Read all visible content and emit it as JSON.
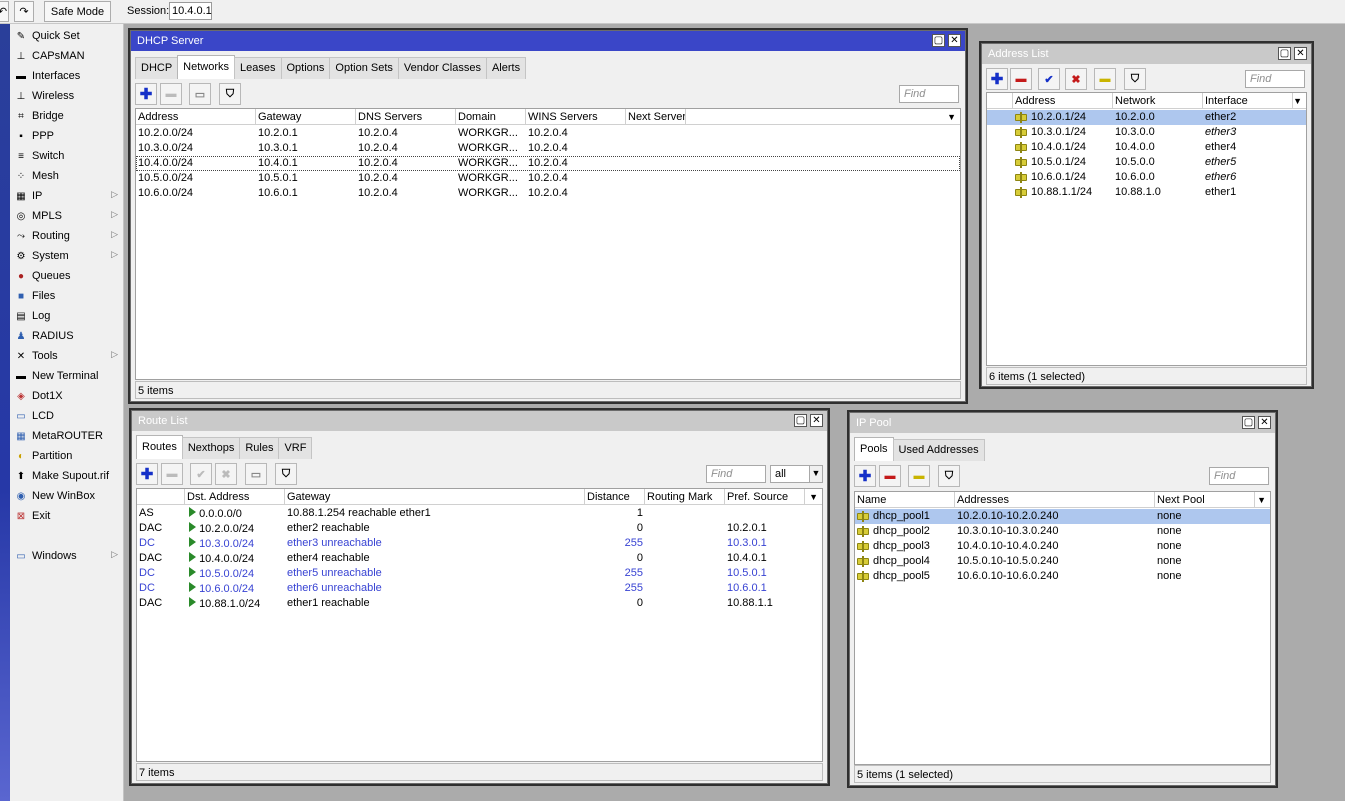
{
  "topbar": {
    "safe_mode": "Safe Mode",
    "session_label": "Session:",
    "session_value": "10.4.0.1"
  },
  "sidebar": {
    "items": [
      {
        "label": "Quick Set",
        "icon": "wand-icon"
      },
      {
        "label": "CAPsMAN",
        "icon": "capsman-icon"
      },
      {
        "label": "Interfaces",
        "icon": "interfaces-icon"
      },
      {
        "label": "Wireless",
        "icon": "wireless-icon"
      },
      {
        "label": "Bridge",
        "icon": "bridge-icon"
      },
      {
        "label": "PPP",
        "icon": "ppp-icon"
      },
      {
        "label": "Switch",
        "icon": "switch-icon"
      },
      {
        "label": "Mesh",
        "icon": "mesh-icon"
      },
      {
        "label": "IP",
        "icon": "ip-icon"
      },
      {
        "label": "MPLS",
        "icon": "mpls-icon"
      },
      {
        "label": "Routing",
        "icon": "routing-icon"
      },
      {
        "label": "System",
        "icon": "system-icon"
      },
      {
        "label": "Queues",
        "icon": "queues-icon"
      },
      {
        "label": "Files",
        "icon": "files-icon"
      },
      {
        "label": "Log",
        "icon": "log-icon"
      },
      {
        "label": "RADIUS",
        "icon": "radius-icon"
      },
      {
        "label": "Tools",
        "icon": "tools-icon"
      },
      {
        "label": "New Terminal",
        "icon": "terminal-icon"
      },
      {
        "label": "Dot1X",
        "icon": "dot1x-icon"
      },
      {
        "label": "LCD",
        "icon": "lcd-icon"
      },
      {
        "label": "MetaROUTER",
        "icon": "metarouter-icon"
      },
      {
        "label": "Partition",
        "icon": "partition-icon"
      },
      {
        "label": "Make Supout.rif",
        "icon": "supout-icon"
      },
      {
        "label": "New WinBox",
        "icon": "winbox-icon"
      },
      {
        "label": "Exit",
        "icon": "exit-icon"
      },
      {
        "label": "Windows",
        "icon": "windows-icon"
      }
    ]
  },
  "dhcp": {
    "title": "DHCP Server",
    "tabs": [
      "DHCP",
      "Networks",
      "Leases",
      "Options",
      "Option Sets",
      "Vendor Classes",
      "Alerts"
    ],
    "find": "Find",
    "columns": [
      "Address",
      "Gateway",
      "DNS Servers",
      "Domain",
      "WINS Servers",
      "Next Server"
    ],
    "rows": [
      [
        "10.2.0.0/24",
        "10.2.0.1",
        "10.2.0.4",
        "WORKGR...",
        "10.2.0.4",
        ""
      ],
      [
        "10.3.0.0/24",
        "10.3.0.1",
        "10.2.0.4",
        "WORKGR...",
        "10.2.0.4",
        ""
      ],
      [
        "10.4.0.0/24",
        "10.4.0.1",
        "10.2.0.4",
        "WORKGR...",
        "10.2.0.4",
        ""
      ],
      [
        "10.5.0.0/24",
        "10.5.0.1",
        "10.2.0.4",
        "WORKGR...",
        "10.2.0.4",
        ""
      ],
      [
        "10.6.0.0/24",
        "10.6.0.1",
        "10.2.0.4",
        "WORKGR...",
        "10.2.0.4",
        ""
      ]
    ],
    "status": "5 items"
  },
  "address_list": {
    "title": "Address List",
    "find": "Find",
    "columns": [
      "Address",
      "Network",
      "Interface"
    ],
    "rows": [
      [
        "10.2.0.1/24",
        "10.2.0.0",
        "ether2"
      ],
      [
        "10.3.0.1/24",
        "10.3.0.0",
        "ether3"
      ],
      [
        "10.4.0.1/24",
        "10.4.0.0",
        "ether4"
      ],
      [
        "10.5.0.1/24",
        "10.5.0.0",
        "ether5"
      ],
      [
        "10.6.0.1/24",
        "10.6.0.0",
        "ether6"
      ],
      [
        "10.88.1.1/24",
        "10.88.1.0",
        "ether1"
      ]
    ],
    "status": "6 items (1 selected)"
  },
  "route_list": {
    "title": "Route List",
    "tabs": [
      "Routes",
      "Nexthops",
      "Rules",
      "VRF"
    ],
    "find": "Find",
    "filter_value": "all",
    "columns": [
      "",
      "Dst. Address",
      "Gateway",
      "Distance",
      "Routing Mark",
      "Pref. Source"
    ],
    "rows": [
      [
        "AS",
        "0.0.0.0/0",
        "10.88.1.254 reachable ether1",
        "1",
        "",
        ""
      ],
      [
        "DAC",
        "10.2.0.0/24",
        "ether2 reachable",
        "0",
        "",
        "10.2.0.1"
      ],
      [
        "DC",
        "10.3.0.0/24",
        "ether3 unreachable",
        "255",
        "",
        "10.3.0.1"
      ],
      [
        "DAC",
        "10.4.0.0/24",
        "ether4 reachable",
        "0",
        "",
        "10.4.0.1"
      ],
      [
        "DC",
        "10.5.0.0/24",
        "ether5 unreachable",
        "255",
        "",
        "10.5.0.1"
      ],
      [
        "DC",
        "10.6.0.0/24",
        "ether6 unreachable",
        "255",
        "",
        "10.6.0.1"
      ],
      [
        "DAC",
        "10.88.1.0/24",
        "ether1 reachable",
        "0",
        "",
        "10.88.1.1"
      ]
    ],
    "status": "7 items"
  },
  "ip_pool": {
    "title": "IP Pool",
    "tabs": [
      "Pools",
      "Used Addresses"
    ],
    "find": "Find",
    "columns": [
      "Name",
      "Addresses",
      "Next Pool"
    ],
    "rows": [
      [
        "dhcp_pool1",
        "10.2.0.10-10.2.0.240",
        "none"
      ],
      [
        "dhcp_pool2",
        "10.3.0.10-10.3.0.240",
        "none"
      ],
      [
        "dhcp_pool3",
        "10.4.0.10-10.4.0.240",
        "none"
      ],
      [
        "dhcp_pool4",
        "10.5.0.10-10.5.0.240",
        "none"
      ],
      [
        "dhcp_pool5",
        "10.6.0.10-10.6.0.240",
        "none"
      ]
    ],
    "status": "5 items (1 selected)"
  }
}
